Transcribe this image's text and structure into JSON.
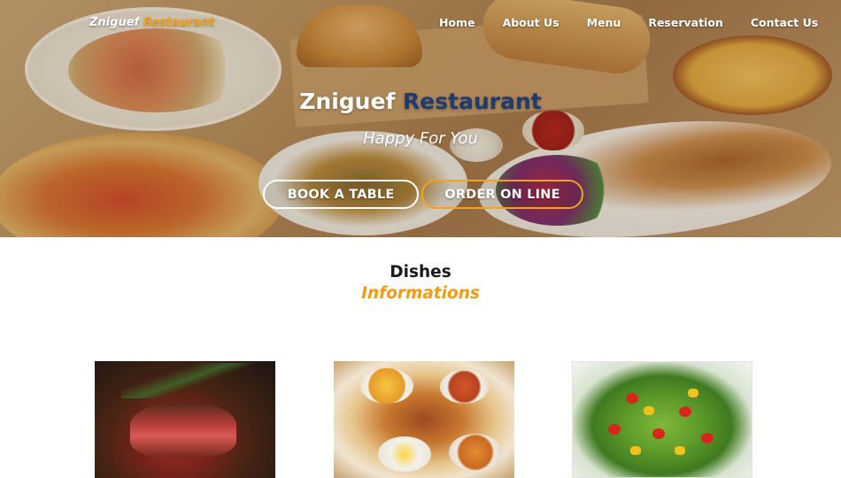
{
  "header": {
    "logo_main": "Zniguef",
    "logo_accent": "Restaurant",
    "nav": [
      {
        "label": "Home"
      },
      {
        "label": "About Us"
      },
      {
        "label": "Menu"
      },
      {
        "label": "Reservation"
      },
      {
        "label": "Contact Us"
      }
    ]
  },
  "hero": {
    "title_main": "Zniguef",
    "title_accent": "Restaurant",
    "subtitle": "Happy For You",
    "book_button": "BOOK A TABLE",
    "order_button": "ORDER ON LINE"
  },
  "dishes": {
    "title": "Dishes",
    "subtitle": "Informations",
    "cards": [
      {
        "image": "steak-photo"
      },
      {
        "image": "mixed-dishes-photo"
      },
      {
        "image": "salad-photo"
      }
    ]
  },
  "colors": {
    "accent": "#f39a14",
    "title_accent": "#1e3c6e"
  }
}
